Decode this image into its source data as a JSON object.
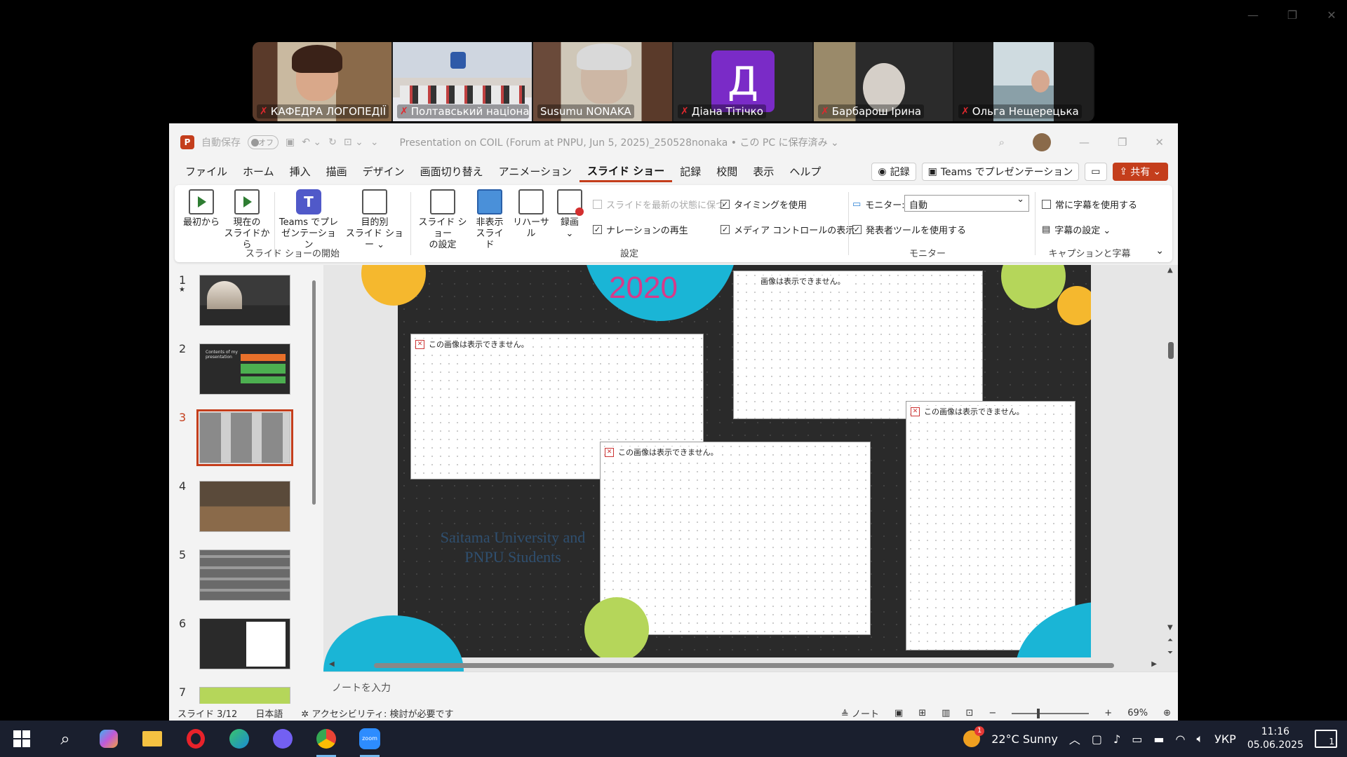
{
  "zoom": {
    "participants": [
      {
        "name": "КАФЕДРА ЛОГОПЕДІЇ",
        "muted": true,
        "active": false
      },
      {
        "name": "Полтавський націона...",
        "muted": true,
        "active": false
      },
      {
        "name": "Susumu NONAKA",
        "muted": false,
        "active": true
      },
      {
        "name": "Діана Тітічко",
        "muted": true,
        "active": false,
        "initial": "Д"
      },
      {
        "name": "Барбарош Ірина",
        "muted": true,
        "active": false
      },
      {
        "name": "Ольга Нещерецька",
        "muted": true,
        "active": false
      }
    ],
    "window_controls": {
      "minimize": "—",
      "restore": "❐",
      "close": "✕"
    }
  },
  "ppt": {
    "autosave_label": "自動保存",
    "autosave_state": "オフ",
    "doc_title": "Presentation on COIL (Forum at PNPU, Jun 5, 2025)_250528nonaka • この PC に保存済み ⌄",
    "menu": [
      "ファイル",
      "ホーム",
      "挿入",
      "描画",
      "デザイン",
      "画面切り替え",
      "アニメーション",
      "スライド ショー",
      "記録",
      "校閲",
      "表示",
      "ヘルプ"
    ],
    "menu_active_index": 7,
    "record_btn": "記録",
    "teams_present_btn": "Teams でプレゼンテーション",
    "share_btn": "共有",
    "ribbon": {
      "from_start": "最初から",
      "from_current_l1": "現在の",
      "from_current_l2": "スライドから",
      "teams_l1": "Teams でプレ",
      "teams_l2": "ゼンテーション",
      "custom_l1": "目的別",
      "custom_l2": "スライド ショー ⌄",
      "group_start": "スライド ショーの開始",
      "setup_l1": "スライド ショー",
      "setup_l2": "の設定",
      "hide_l1": "非表示",
      "hide_l2": "スライド",
      "rehearse": "リハーサル",
      "record_l1": "録画",
      "record_l2": "⌄",
      "keep_updated": "スライドを最新の状態に保つ",
      "use_timings": "タイミングを使用",
      "play_narrations": "ナレーションの再生",
      "show_media": "メディア コントロールの表示",
      "group_setup": "設定",
      "monitor_label": "モニター:",
      "monitor_value": "自動",
      "presenter_view": "発表者ツールを使用する",
      "group_monitor": "モニター",
      "always_subtitles": "常に字幕を使用する",
      "subtitle_settings": "字幕の設定 ⌄",
      "group_captions": "キャプションと字幕"
    },
    "thumbnails": [
      {
        "num": "1",
        "star": "★"
      },
      {
        "num": "2"
      },
      {
        "num": "3",
        "selected": true
      },
      {
        "num": "4"
      },
      {
        "num": "5"
      },
      {
        "num": "6"
      },
      {
        "num": "7"
      }
    ],
    "thumb2_title": "Contents of my presentation",
    "slide": {
      "year": "2020",
      "placeholder_msg": "この画像は表示できません。",
      "placeholder_msg_cut": "画像は表示できません。",
      "faded_text": "Saitama University and PNPU Students"
    },
    "notes_placeholder": "ノートを入力",
    "status": {
      "slide_counter": "スライド 3/12",
      "language": "日本語",
      "accessibility": "アクセシビリティ: 検討が必要です",
      "notes_btn": "ノート",
      "zoom": "69%"
    }
  },
  "taskbar": {
    "weather": "22°C  Sunny",
    "language": "УКР",
    "time": "11:16",
    "date": "05.06.2025",
    "notifications": "1"
  },
  "colors": {
    "ppt_accent": "#c43e1c",
    "slide_cyan": "#1ab5d6",
    "slide_yellow": "#f5b82e",
    "slide_green": "#b5d65a",
    "year_pink": "#d63b8a",
    "zoom_active": "#23d160"
  }
}
